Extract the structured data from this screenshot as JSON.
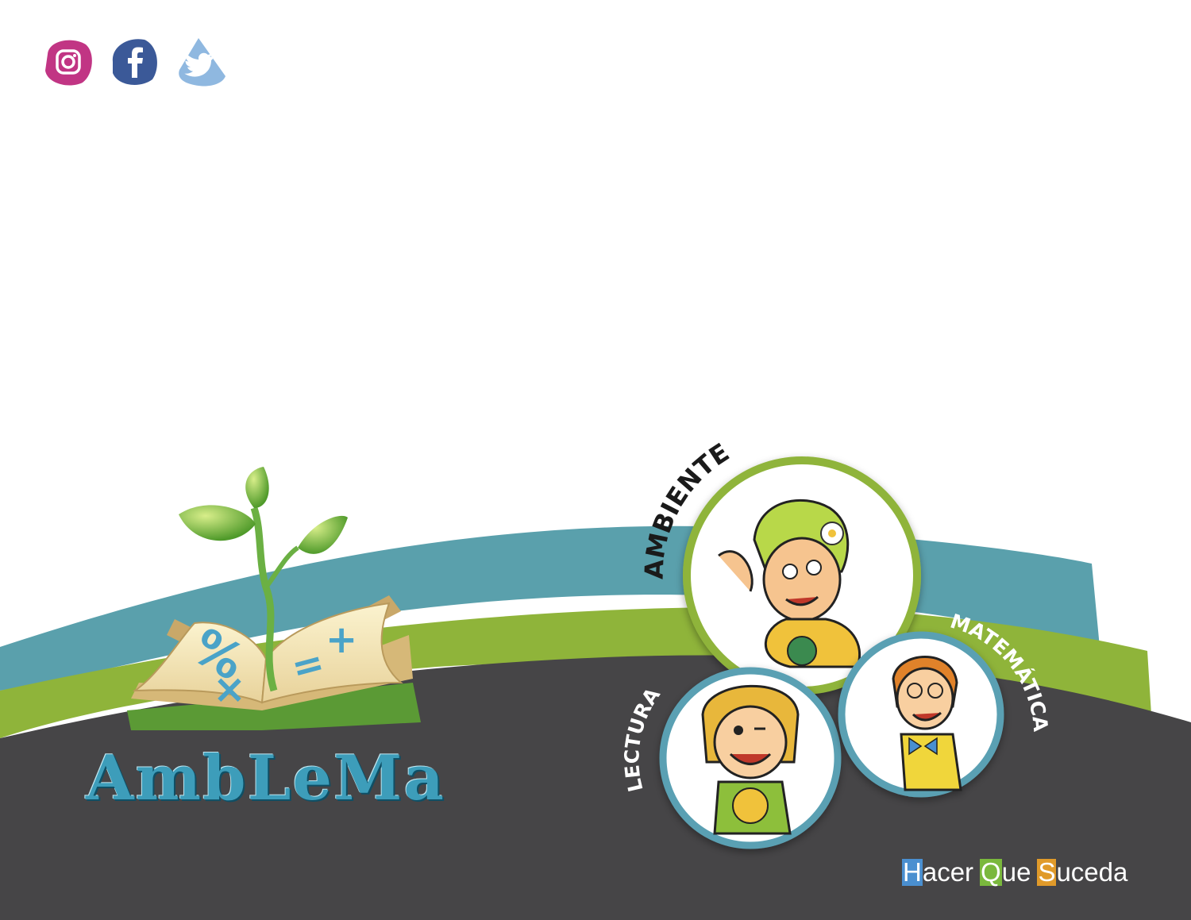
{
  "social": {
    "items": [
      {
        "name": "instagram",
        "icon": "instagram-icon",
        "color": "#c13584"
      },
      {
        "name": "facebook",
        "icon": "facebook-icon",
        "color": "#3b5998"
      },
      {
        "name": "twitter",
        "icon": "twitter-icon",
        "color": "#8fb8e0"
      }
    ]
  },
  "brand": {
    "name": "AmbLeMa",
    "emblem_symbols": [
      "%",
      "+",
      "=",
      "×"
    ]
  },
  "characters": {
    "ambiente": {
      "label": "AMBIENTE",
      "ring_color": "#8fb43a"
    },
    "lectura": {
      "label": "LECTURA",
      "ring_color": "#5aa0b3"
    },
    "matematica": {
      "label": "MATEMÁTICA",
      "ring_color": "#5aa0b3"
    }
  },
  "slogan": {
    "words": [
      {
        "initial": "H",
        "rest": "acer",
        "color": "#4a8fd0"
      },
      {
        "initial": "Q",
        "rest": "ue",
        "color": "#7ab83d"
      },
      {
        "initial": "S",
        "rest": "uceda",
        "color": "#e09a2a"
      }
    ]
  },
  "colors": {
    "teal_band": "#5aa0ac",
    "green_band": "#8fb43a",
    "dark_ground": "#464547"
  }
}
